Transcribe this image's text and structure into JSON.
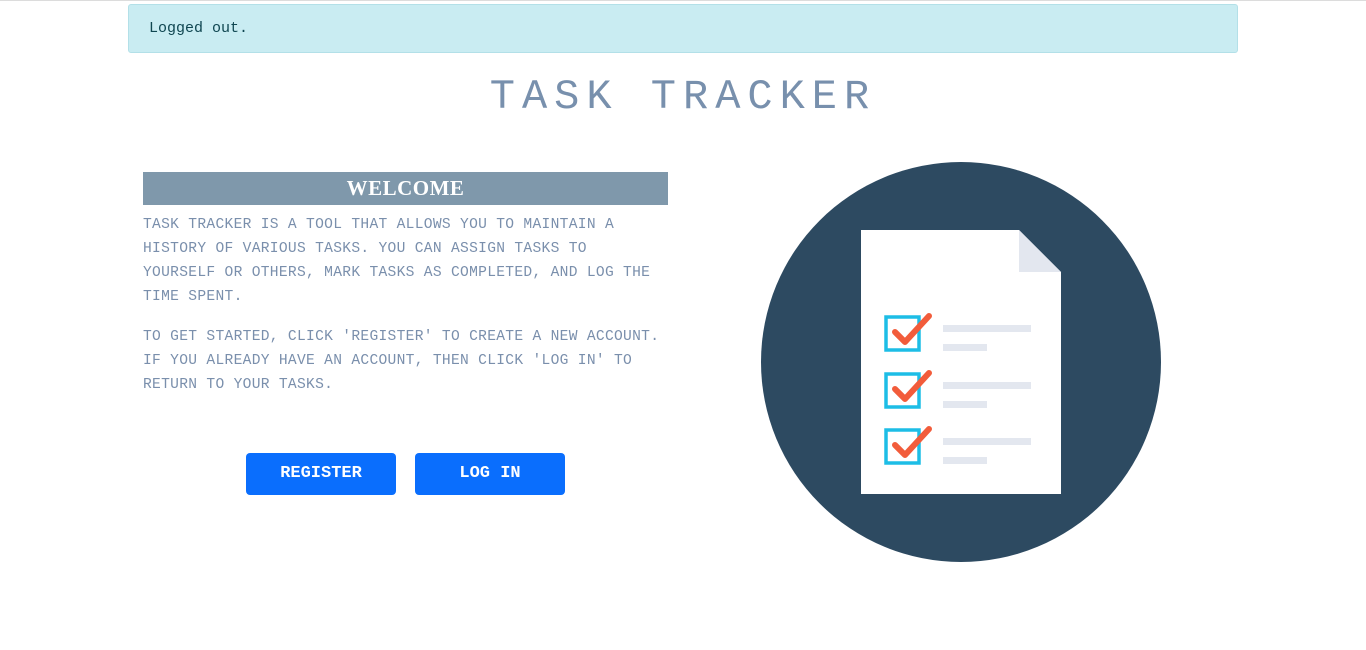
{
  "alert": {
    "message": "Logged out."
  },
  "header": {
    "title": "TASK TRACKER"
  },
  "welcome": {
    "heading": "WELCOME",
    "paragraph_1": "TASK TRACKER IS A TOOL THAT ALLOWS YOU TO MAINTAIN A HISTORY OF VARIOUS TASKS. YOU CAN ASSIGN TASKS TO YOURSELF OR OTHERS, MARK TASKS AS COMPLETED, AND LOG THE TIME SPENT.",
    "paragraph_2": "TO GET STARTED, CLICK 'REGISTER' TO CREATE A NEW ACCOUNT. IF YOU ALREADY HAVE AN ACCOUNT, THEN CLICK 'LOG IN' TO RETURN TO YOUR TASKS."
  },
  "actions": {
    "register_label": "REGISTER",
    "login_label": "LOG IN"
  },
  "illustration": {
    "icon": "checklist-document-icon",
    "colors": {
      "circle": "#2d4a61",
      "paper": "#ffffff",
      "fold": "#e3e7ef",
      "checkbox": "#1dbde6",
      "checkmark": "#f25c3b",
      "lines": "#e3e7ef"
    }
  },
  "colors": {
    "alert_bg": "#c9ecf2",
    "title": "#7890ad",
    "welcome_bar": "#7f98ab",
    "body_text": "#7a8fac",
    "button": "#0a6efd"
  }
}
